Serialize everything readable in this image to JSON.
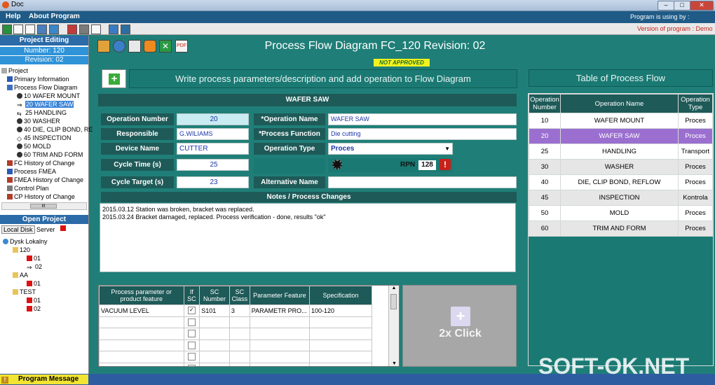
{
  "window": {
    "title": "Doc",
    "minimize": "–",
    "maximize": "□",
    "close": "✕"
  },
  "menu": {
    "help": "Help",
    "about": "About Program",
    "used_by": "Program is using by :",
    "version": "Version of program : Demo"
  },
  "left": {
    "project_editing": "Project Editing",
    "number": "Number: 120",
    "revision": "Revision: 02",
    "tree": [
      "Project",
      "Primary Information",
      "Process Flow Diagram",
      "10 WAFER MOUNT",
      "20 WAFER SAW",
      "25 HANDLING",
      "30 WASHER",
      "40 DIE, CLIP BOND, RE",
      "45 INSPECTION",
      "50 MOLD",
      "60 TRIM AND FORM",
      "FC History of Change",
      "Process FMEA",
      "FMEA History of Change",
      "Control Plan",
      "CP History of Change"
    ],
    "scroll_label": "III",
    "open_project": "Open Project",
    "local_disk": "Local Disk",
    "server": "Server",
    "disk_tree": [
      "Dysk Lokalny",
      "120",
      "01",
      "02",
      "AA",
      "01",
      "TEST",
      "01",
      "02"
    ],
    "program_message": "Program Message"
  },
  "main": {
    "title": "Process Flow Diagram FC_120 Revision: 02",
    "status": "NOT APPROVED",
    "instruction": "Write process parameters/description and add operation to Flow Diagram",
    "operation_header": "WAFER SAW",
    "form": {
      "op_number_label": "Operation Number",
      "op_number": "20",
      "op_name_label": "*Operation Name",
      "op_name": "WAFER SAW",
      "responsible_label": "Responsible",
      "responsible": "G.WILIAMS",
      "function_label": "*Process Function",
      "function": "Die cutting",
      "device_label": "Device Name",
      "device": "CUTTER",
      "optype_label": "Operation Type",
      "optype": "Proces",
      "cycle_label": "Cycle Time (s)",
      "cycle": "25",
      "rpn_label": "RPN",
      "rpn": "128",
      "target_label": "Cycle Target (s)",
      "target": "23",
      "alt_label": "Alternative Name",
      "alt": ""
    },
    "notes_header": "Notes / Process Changes",
    "notes": [
      "2015.03.12 Station was broken, bracket was replaced.",
      "2015.03.24 Bracket damaged, replaced. Process verification - done, results \"ok\""
    ],
    "param_headers": [
      "Process parameter or product feature",
      "If SC",
      "SC Number",
      "SC Class",
      "Parameter Feature",
      "Specification"
    ],
    "param_rows": [
      [
        "VACUUM LEVEL",
        "✓",
        "S101",
        "3",
        "PARAMETR PRO...",
        "100-120"
      ]
    ],
    "click_label": "2x Click"
  },
  "flow": {
    "title": "Table of Process Flow",
    "headers": [
      "Operation Number",
      "Operation Name",
      "Operation Type"
    ],
    "rows": [
      [
        "10",
        "WAFER MOUNT",
        "Proces"
      ],
      [
        "20",
        "WAFER SAW",
        "Proces"
      ],
      [
        "25",
        "HANDLING",
        "Transport"
      ],
      [
        "30",
        "WASHER",
        "Proces"
      ],
      [
        "40",
        "DIE, CLIP BOND, REFLOW",
        "Proces"
      ],
      [
        "45",
        "INSPECTION",
        "Kontrola"
      ],
      [
        "50",
        "MOLD",
        "Proces"
      ],
      [
        "60",
        "TRIM AND FORM",
        "Proces"
      ]
    ],
    "selected_row": 1
  },
  "watermark": "SOFT-OK.NET",
  "colors": {
    "teal": "#1f7f78",
    "dark": "#1e5a58",
    "selected": "#9b6fd0",
    "accent": "#2b6ba8"
  }
}
